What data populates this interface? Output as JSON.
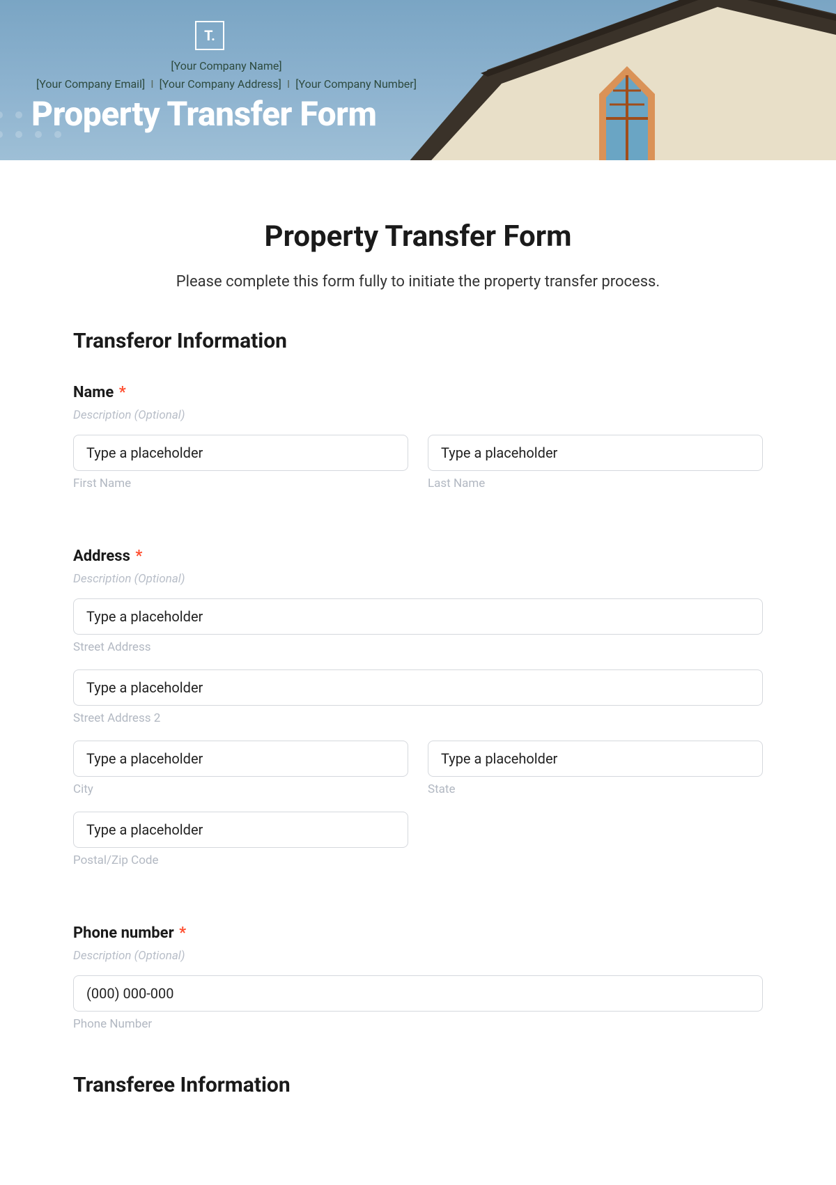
{
  "hero": {
    "logo_text": "T.",
    "company_name": "[Your Company Name]",
    "company_email": "[Your Company Email]",
    "company_address": "[Your Company Address]",
    "company_number": "[Your Company Number]",
    "separator": "I",
    "title": "Property Transfer Form"
  },
  "form": {
    "title": "Property Transfer Form",
    "intro": "Please complete this form fully to initiate the property transfer process."
  },
  "sections": {
    "transferor": {
      "heading": "Transferor Information",
      "name": {
        "label": "Name",
        "required": "*",
        "desc": "Description (Optional)",
        "first_placeholder": "Type a placeholder",
        "first_sub": "First Name",
        "last_placeholder": "Type a placeholder",
        "last_sub": "Last Name"
      },
      "address": {
        "label": "Address",
        "required": "*",
        "desc": "Description (Optional)",
        "street_placeholder": "Type a placeholder",
        "street_sub": "Street Address",
        "street2_placeholder": "Type a placeholder",
        "street2_sub": "Street Address 2",
        "city_placeholder": "Type a placeholder",
        "city_sub": "City",
        "state_placeholder": "Type a placeholder",
        "state_sub": "State",
        "postal_placeholder": "Type a placeholder",
        "postal_sub": "Postal/Zip Code"
      },
      "phone": {
        "label": "Phone number",
        "required": "*",
        "desc": "Description (Optional)",
        "placeholder": "(000) 000-000",
        "sub": "Phone Number"
      }
    },
    "transferee": {
      "heading": "Transferee Information"
    }
  }
}
